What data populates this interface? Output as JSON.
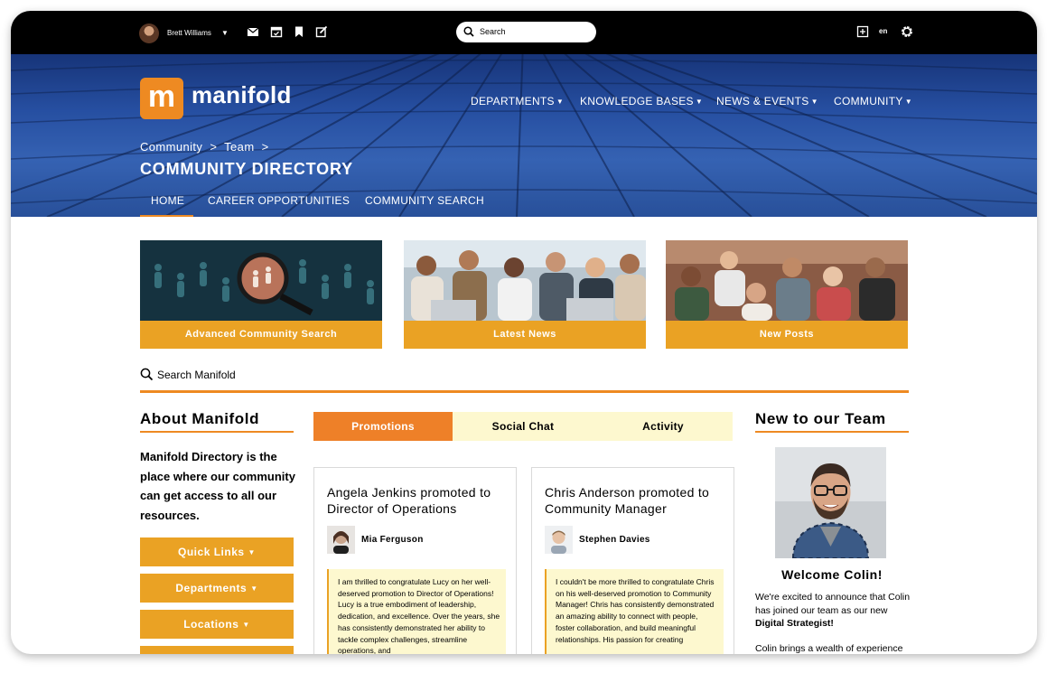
{
  "topbar": {
    "user_name": "Brett Williams",
    "search_placeholder": "Search",
    "language": "en"
  },
  "header": {
    "logo_letter": "m",
    "logo_text": "manifold",
    "nav": [
      "DEPARTMENTS",
      "KNOWLEDGE BASES",
      "NEWS & EVENTS",
      "COMMUNITY"
    ],
    "breadcrumb": [
      "Community",
      "Team"
    ],
    "page_title": "COMMUNITY DIRECTORY",
    "subnav": [
      "HOME",
      "CAREER OPPORTUNITIES",
      "COMMUNITY SEARCH"
    ]
  },
  "cards": [
    {
      "label": "Advanced Community Search"
    },
    {
      "label": "Latest News"
    },
    {
      "label": "New Posts"
    }
  ],
  "site_search": {
    "placeholder": "Search Manifold"
  },
  "about": {
    "title": "About Manifold",
    "text": "Manifold Directory is the place where our community can get access to all our resources.",
    "buttons": [
      "Quick Links",
      "Departments",
      "Locations"
    ]
  },
  "tabs": [
    {
      "label": "Promotions",
      "active": true
    },
    {
      "label": "Social Chat",
      "active": false
    },
    {
      "label": "Activity",
      "active": false
    }
  ],
  "posts": [
    {
      "title": "Angela Jenkins promoted to Director of Operations",
      "author": "Mia Ferguson",
      "body": "I am thrilled to congratulate Lucy on her well-deserved promotion to Director of Operations! Lucy is a true embodiment of leadership, dedication, and excellence. Over the years, she has consistently demonstrated her ability to tackle complex challenges, streamline operations, and"
    },
    {
      "title": "Chris Anderson promoted to Community Manager",
      "author": "Stephen Davies",
      "body": "I couldn't be more thrilled to congratulate Chris on his well-deserved promotion to Community Manager! Chris has consistently demonstrated an amazing ability to connect with people, foster collaboration, and build meaningful relationships. His passion for creating"
    }
  ],
  "new_team": {
    "title": "New to our Team",
    "welcome": "Welcome Colin!",
    "text_before": "We're excited to announce that Colin has joined our team as our new ",
    "role": "Digital Strategist!",
    "text_more": "Colin brings a wealth of experience"
  },
  "colors": {
    "accent_orange": "#ee8a22",
    "button_gold": "#eaa224",
    "tab_bg": "#fdf8cf",
    "hero_blue": "#2d5bb7"
  }
}
